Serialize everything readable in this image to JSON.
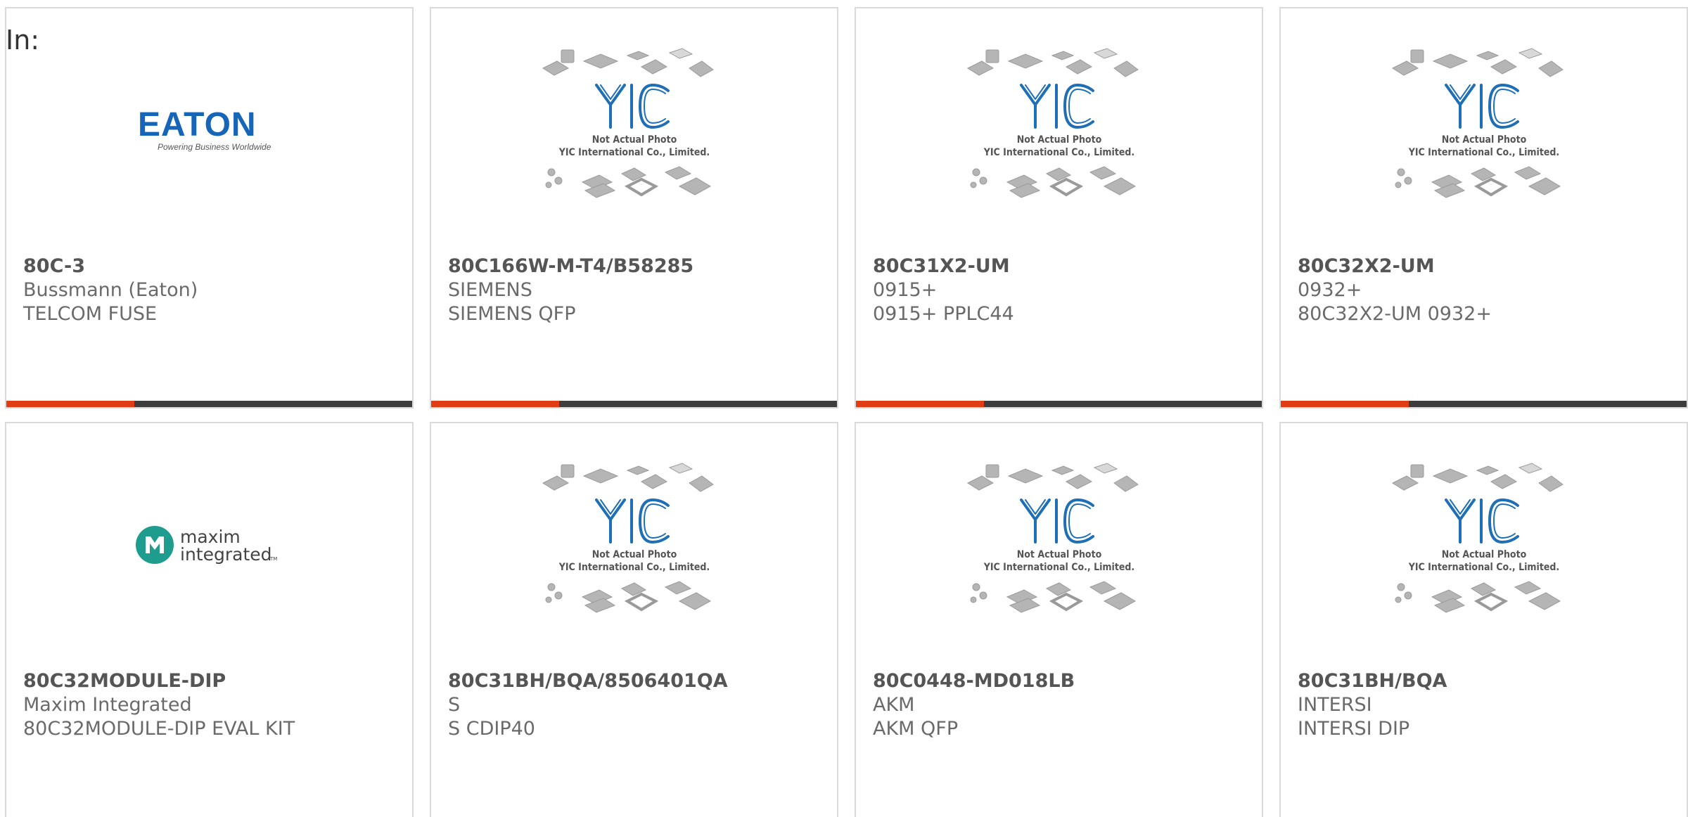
{
  "header": {
    "label": "In:"
  },
  "products": [
    {
      "part": "80C-3",
      "line1": "Bussmann (Eaton)",
      "line2": "TELCOM FUSE",
      "image": "eaton-logo"
    },
    {
      "part": "80C166W-M-T4/B58285",
      "line1": "SIEMENS",
      "line2": "SIEMENS QFP",
      "image": "yic-placeholder"
    },
    {
      "part": "80C31X2-UM",
      "line1": "0915+",
      "line2": "0915+ PPLC44",
      "image": "yic-placeholder"
    },
    {
      "part": "80C32X2-UM",
      "line1": "0932+",
      "line2": "80C32X2-UM 0932+",
      "image": "yic-placeholder"
    },
    {
      "part": "80C32MODULE-DIP",
      "line1": "Maxim Integrated",
      "line2": "80C32MODULE-DIP EVAL KIT",
      "image": "maxim-logo"
    },
    {
      "part": "80C31BH/BQA/8506401QA",
      "line1": "S",
      "line2": "S CDIP40",
      "image": "yic-placeholder"
    },
    {
      "part": "80C0448-MD018LB",
      "line1": "AKM",
      "line2": "AKM QFP",
      "image": "yic-placeholder"
    },
    {
      "part": "80C31BH/BQA",
      "line1": "INTERSI",
      "line2": "INTERSI DIP",
      "image": "yic-placeholder"
    }
  ],
  "logos": {
    "eaton": {
      "name": "EATON",
      "tagline": "Powering Business Worldwide"
    },
    "maxim": {
      "line1": "maxim",
      "line2": "integrated",
      "tm": "TM"
    },
    "yic": {
      "mark": "YIC",
      "caption1": "Not Actual Photo",
      "caption2": "YIC International Co., Limited."
    }
  },
  "colors": {
    "accent": "#e03c16",
    "bar": "#3d3d3d",
    "eaton_blue": "#1565b8",
    "maxim_teal": "#1e9c8e",
    "yic_blue": "#1f6fb6"
  }
}
